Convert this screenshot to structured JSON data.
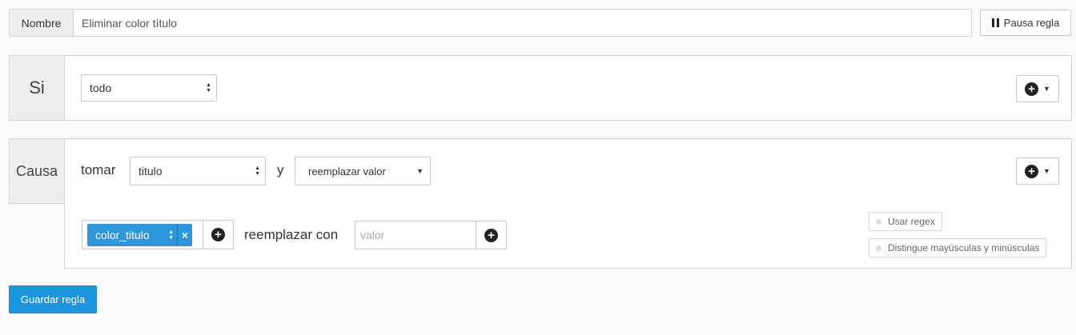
{
  "name_row": {
    "label": "Nombre",
    "value": "Eliminar color título",
    "pause_button": "Pausa regla"
  },
  "si": {
    "label": "Si",
    "condition_select": "todo",
    "add_button_icon": "plus-circle-icon"
  },
  "causa": {
    "label": "Causa",
    "take_word": "tomar",
    "field_select": "titulo",
    "and_word": "y",
    "action_select": "reemplazar valor",
    "tag": "color_titulo",
    "tag_remove": "×",
    "replace_with": "reemplazar con",
    "value_placeholder": "valor",
    "options": {
      "use_regex": "Usar regex",
      "case_sensitive": "Distingue mayúsculas y minúsculas"
    }
  },
  "save_button": "Guardar regla",
  "colors": {
    "primary": "#1c95dc",
    "tag": "#2f96dc",
    "addon_bg": "#eeeeee"
  }
}
